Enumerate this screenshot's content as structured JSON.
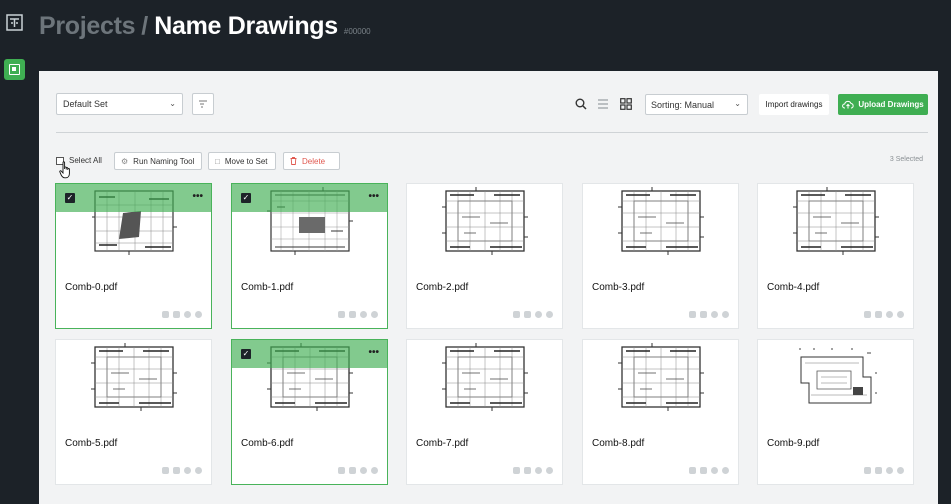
{
  "header": {
    "parent": "Projects",
    "separator": "/",
    "title": "Name Drawings",
    "project_id": "#00000"
  },
  "toolbar": {
    "set_select": "Default Set",
    "sort_select": "Sorting: Manual",
    "import_label": "Import drawings",
    "upload_label": "Upload Drawings"
  },
  "actions": {
    "select_all": "Select All",
    "run_naming": "Run Naming Tool",
    "move_to_set": "Move to Set",
    "delete": "Delete",
    "selected_count": "3 Selected"
  },
  "drawings": [
    {
      "name": "Comb-0.pdf",
      "selected": true,
      "variant": "A"
    },
    {
      "name": "Comb-1.pdf",
      "selected": true,
      "variant": "B"
    },
    {
      "name": "Comb-2.pdf",
      "selected": false,
      "variant": "C"
    },
    {
      "name": "Comb-3.pdf",
      "selected": false,
      "variant": "C"
    },
    {
      "name": "Comb-4.pdf",
      "selected": false,
      "variant": "C"
    },
    {
      "name": "Comb-5.pdf",
      "selected": false,
      "variant": "C"
    },
    {
      "name": "Comb-6.pdf",
      "selected": true,
      "variant": "C"
    },
    {
      "name": "Comb-7.pdf",
      "selected": false,
      "variant": "C"
    },
    {
      "name": "Comb-8.pdf",
      "selected": false,
      "variant": "C"
    },
    {
      "name": "Comb-9.pdf",
      "selected": false,
      "variant": "D"
    }
  ],
  "colors": {
    "accent": "#3fae52",
    "background": "#1c2228",
    "panel": "#f2f3f4",
    "danger": "#e0584f"
  },
  "icons": [
    "logo-icon",
    "drawings-nav-icon",
    "filter-icon",
    "search-icon",
    "list-view-icon",
    "grid-view-icon",
    "cloud-upload-icon",
    "naming-tool-icon",
    "move-icon",
    "trash-icon",
    "more-icon",
    "check-icon"
  ]
}
